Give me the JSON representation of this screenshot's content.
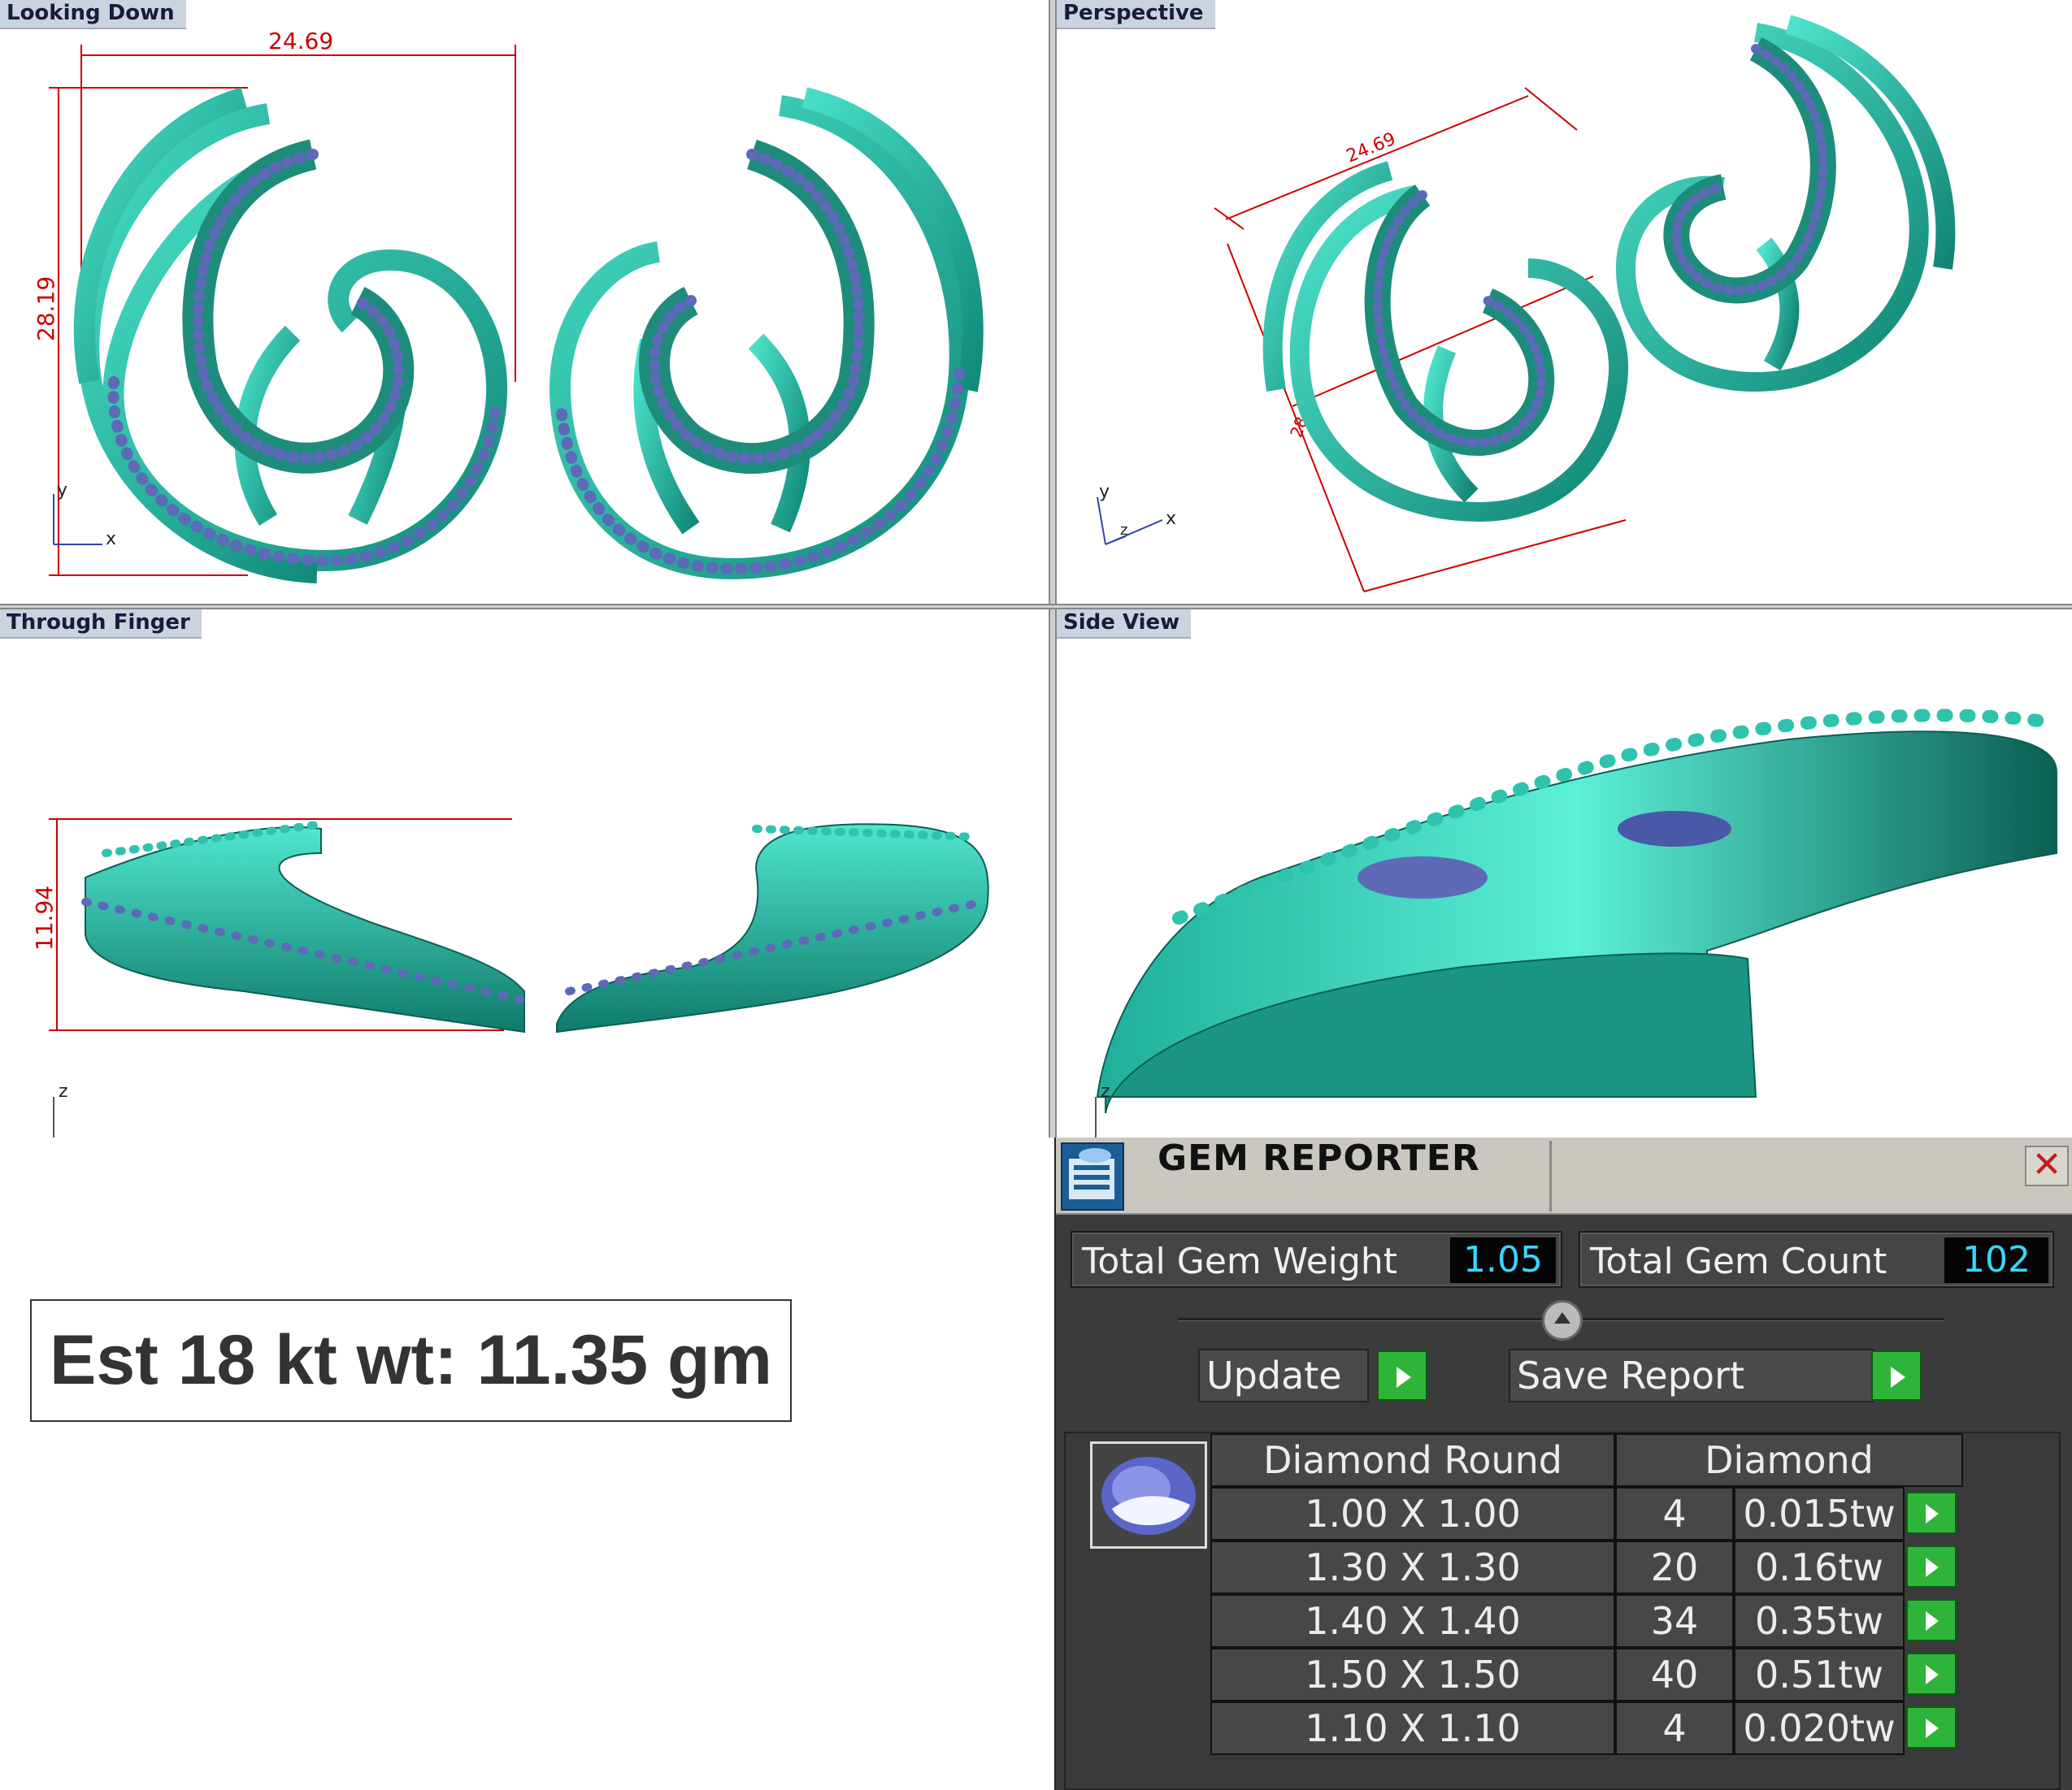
{
  "viewports": {
    "top_left": {
      "label": "Looking Down",
      "dim_width": "24.69",
      "dim_height": "28.19",
      "axis_x": "x",
      "axis_y": "y"
    },
    "top_right": {
      "label": "Perspective",
      "dim_width": "24.69",
      "dim_height": "28.19",
      "axis_x": "x",
      "axis_y": "y",
      "axis_z": "z"
    },
    "bottom_left": {
      "label": "Through Finger",
      "dim_height": "11.94",
      "axis_z": "z"
    },
    "bottom_right": {
      "label": "Side View",
      "axis_z": "z"
    }
  },
  "weight_label": "Est 18 kt wt: 11.35 gm",
  "gem_reporter": {
    "title": "GEM REPORTER",
    "close_icon": "close-icon",
    "total_weight_label": "Total Gem Weight",
    "total_weight_value": "1.05",
    "total_count_label": "Total Gem Count",
    "total_count_value": "102",
    "update_label": "Update",
    "save_report_label": "Save Report",
    "columns": [
      "Diamond Round",
      "Diamond"
    ],
    "rows": [
      {
        "size": "1.00 X 1.00",
        "count": "4",
        "weight": "0.015tw"
      },
      {
        "size": "1.30 X 1.30",
        "count": "20",
        "weight": "0.16tw"
      },
      {
        "size": "1.40 X 1.40",
        "count": "34",
        "weight": "0.35tw"
      },
      {
        "size": "1.50 X 1.50",
        "count": "40",
        "weight": "0.51tw"
      },
      {
        "size": "1.10 X 1.10",
        "count": "4",
        "weight": "0.020tw"
      }
    ]
  },
  "colors": {
    "metal": "#2fc3ae",
    "stone": "#5c6ab8",
    "dimension": "#cc0000",
    "value_text": "#38d7ff"
  }
}
